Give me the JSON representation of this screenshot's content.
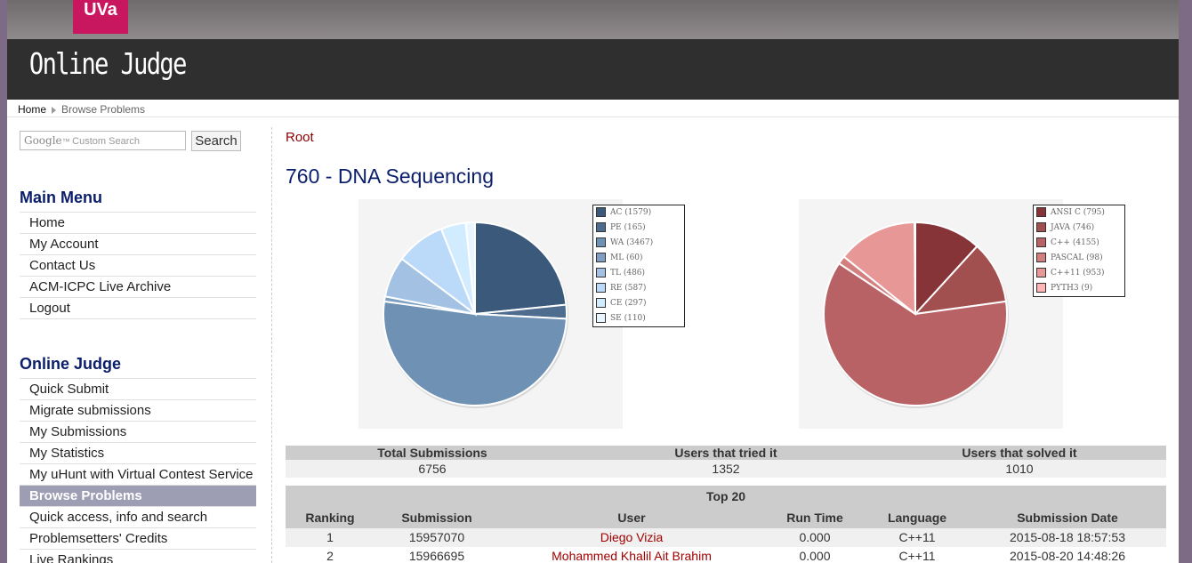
{
  "header": {
    "logo_text": "UVa",
    "site_title": "Online Judge"
  },
  "breadcrumb": {
    "home": "Home",
    "current": "Browse Problems"
  },
  "search": {
    "brand": "Google",
    "placeholder": "Custom Search",
    "button": "Search"
  },
  "main_menu": {
    "title": "Main Menu",
    "items": [
      "Home",
      "My Account",
      "Contact Us",
      "ACM-ICPC Live Archive",
      "Logout"
    ]
  },
  "online_judge_menu": {
    "title": "Online Judge",
    "items": [
      "Quick Submit",
      "Migrate submissions",
      "My Submissions",
      "My Statistics",
      "My uHunt with Virtual Contest Service",
      "Browse Problems",
      "Quick access, info and search",
      "Problemsetters' Credits",
      "Live Rankings"
    ],
    "active": "Browse Problems"
  },
  "content": {
    "root_link": "Root",
    "problem_title": "760 - DNA Sequencing"
  },
  "verdict_chart": {
    "type": "pie",
    "slices": [
      {
        "label": "AC (1579)",
        "value": 1579,
        "color": "#3b5a7b"
      },
      {
        "label": "PE (165)",
        "value": 165,
        "color": "#4d6c8e"
      },
      {
        "label": "WA (3467)",
        "value": 3467,
        "color": "#6f91b4"
      },
      {
        "label": "ML (60)",
        "value": 60,
        "color": "#7f9fc2"
      },
      {
        "label": "TL (486)",
        "value": 486,
        "color": "#a3c2e3"
      },
      {
        "label": "RE (587)",
        "value": 587,
        "color": "#bbd9f8"
      },
      {
        "label": "CE (297)",
        "value": 297,
        "color": "#d2ecff"
      },
      {
        "label": "SE (110)",
        "value": 110,
        "color": "#e8f6ff"
      }
    ]
  },
  "language_chart": {
    "type": "pie",
    "slices": [
      {
        "label": "ANSI C (795)",
        "value": 795,
        "color": "#863437"
      },
      {
        "label": "JAVA (746)",
        "value": 746,
        "color": "#a24f50"
      },
      {
        "label": "C++ (4155)",
        "value": 4155,
        "color": "#b96265"
      },
      {
        "label": "PASCAL (98)",
        "value": 98,
        "color": "#d27f80"
      },
      {
        "label": "C++11 (953)",
        "value": 953,
        "color": "#e89797"
      },
      {
        "label": "PYTH3 (9)",
        "value": 9,
        "color": "#fdb5b5"
      }
    ]
  },
  "stats": {
    "headers": [
      "Total Submissions",
      "Users that tried it",
      "Users that solved it"
    ],
    "values": [
      "6756",
      "1352",
      "1010"
    ]
  },
  "top20": {
    "title": "Top 20",
    "columns": [
      "Ranking",
      "Submission",
      "User",
      "Run Time",
      "Language",
      "Submission Date"
    ],
    "rows": [
      [
        "1",
        "15957070",
        "Diego Vizia",
        "0.000",
        "C++11",
        "2015-08-18 18:57:53"
      ],
      [
        "2",
        "15966695",
        "Mohammed Khalil Ait Brahim",
        "0.000",
        "C++11",
        "2015-08-20 14:48:26"
      ]
    ]
  }
}
